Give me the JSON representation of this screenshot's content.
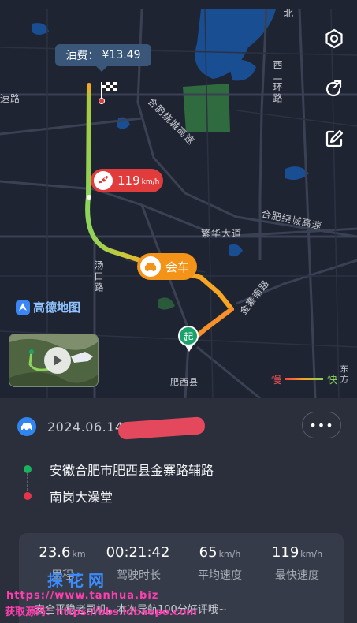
{
  "map": {
    "fee_label": "油费：",
    "fee_value": "¥13.49",
    "max_speed_value": "119",
    "max_speed_unit": "km/h",
    "meet_label": "会车",
    "start_label": "起",
    "logo_text": "高德地图",
    "legend_slow": "慢",
    "legend_fast": "快",
    "road_labels": {
      "north": "北一",
      "speed_road": "速路",
      "hefei_ring_expressway": "合肥绕城高速",
      "west_ring_2": "西二环路",
      "hefei_ring_expressway_2": "合肥绕城高速",
      "fanhua_avenue": "繁华大道",
      "tangkou_road": "汤口路",
      "jinzhai_south_road": "金寨南路",
      "feixi_county": "肥西县",
      "dongfang": "东方"
    },
    "side_buttons": [
      "settings-icon",
      "share-icon",
      "edit-icon"
    ],
    "colors": {
      "route_fast": "#8cd45a",
      "route_slow": "#f34a3a",
      "route_mid": "#f6a623",
      "water": "#1a4e93",
      "green": "#2f6b3e"
    }
  },
  "trip": {
    "date": "2024.06.14",
    "more_label": "•••",
    "origin": "安徽合肥市肥西县金寨路辅路",
    "destination": "南岗大澡堂",
    "stats": [
      {
        "value": "23.6",
        "unit": "km",
        "label": "里程"
      },
      {
        "value": "00:21:42",
        "unit": "",
        "label": "驾驶时长"
      },
      {
        "value": "65",
        "unit": "km/h",
        "label": "平均速度"
      },
      {
        "value": "119",
        "unit": "km/h",
        "label": "最快速度"
      }
    ],
    "tip": "安全平稳老司机，本次导航100分好评哦~"
  },
  "watermark": {
    "line1": "探花网",
    "line2": "https://www.tanhua.biz",
    "line3": "获取源码：https://bbs.ldbaopo.com"
  }
}
